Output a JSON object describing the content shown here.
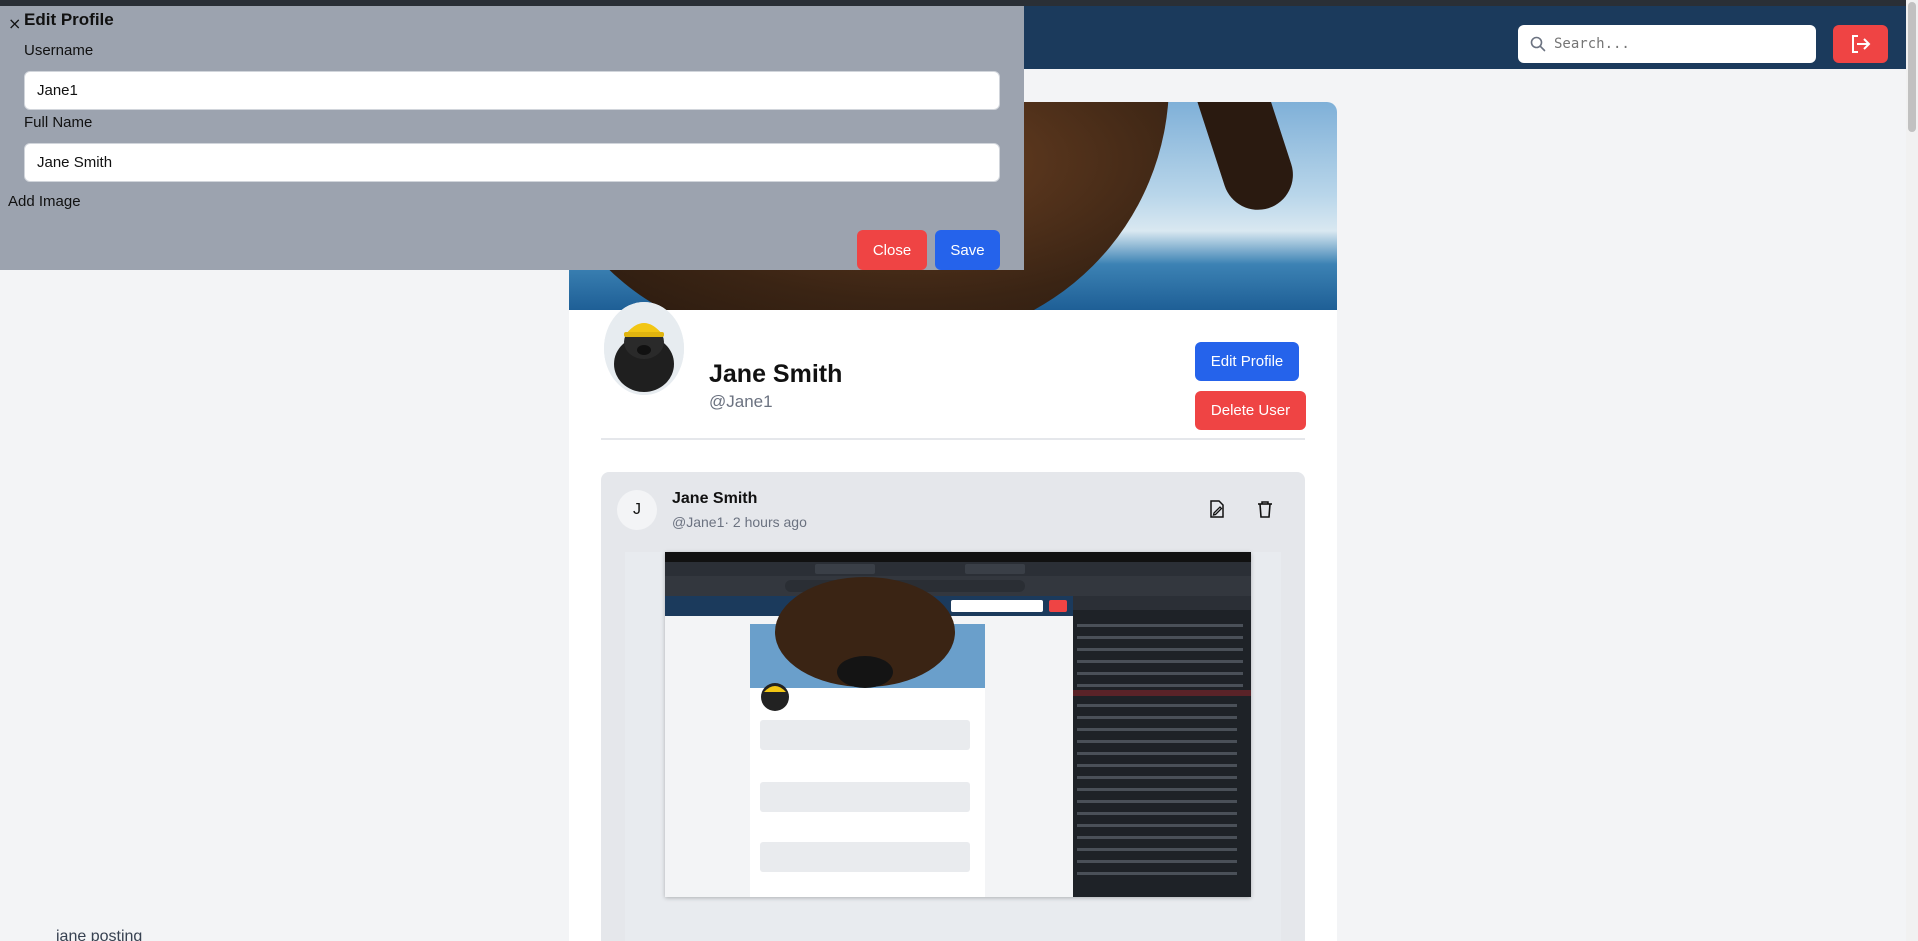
{
  "navbar": {
    "search_placeholder": "Search...",
    "logout_icon": "logout-icon"
  },
  "profile": {
    "name": "Jane Smith",
    "handle": "@Jane1",
    "edit_label": "Edit Profile",
    "delete_label": "Delete User"
  },
  "post": {
    "avatar_initial": "J",
    "author": "Jane Smith",
    "meta": "@Jane1· 2 hours ago",
    "text": "jane posting"
  },
  "modal": {
    "title": "Edit Profile",
    "close_symbol": "×",
    "username_label": "Username",
    "username_value": "Jane1",
    "fullname_label": "Full Name",
    "fullname_value": "Jane Smith",
    "add_image_label": "Add Image",
    "close_label": "Close",
    "save_label": "Save"
  },
  "colors": {
    "navbar": "#1b3a5c",
    "primary": "#2563eb",
    "danger": "#ef4444",
    "modal_bg": "#9ca3af"
  }
}
